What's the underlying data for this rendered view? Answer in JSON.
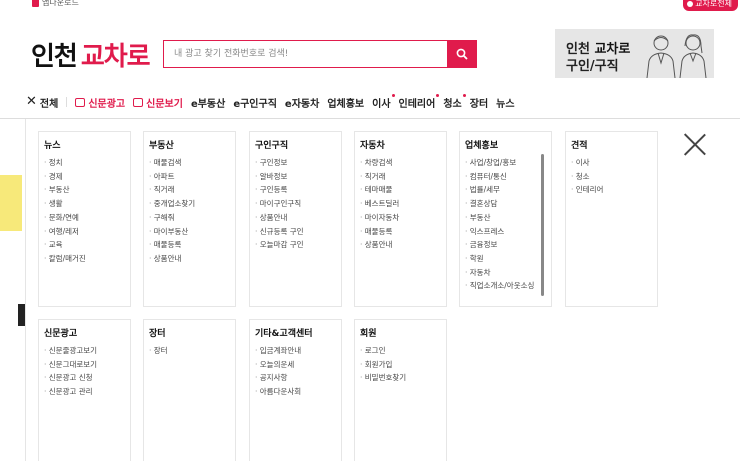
{
  "topbar": {
    "app_download": "앱다운로드",
    "mode_button": "교차로전체"
  },
  "header": {
    "logo_city": "인천",
    "logo_brand": "교차로",
    "search_placeholder": "내 광고 찾기 전화번호로 검색!",
    "banner_line1_a": "인천 ",
    "banner_line1_b": "교차로",
    "banner_line2": "구인/구직"
  },
  "nav": {
    "all": "전체",
    "items": [
      {
        "label": "신문광고"
      },
      {
        "label": "신문보기"
      },
      {
        "label": "e부동산"
      },
      {
        "label": "e구인구직"
      },
      {
        "label": "e자동차"
      },
      {
        "label": "업체홍보"
      },
      {
        "label": "이사"
      },
      {
        "label": "인테리어"
      },
      {
        "label": "청소"
      },
      {
        "label": "장터"
      },
      {
        "label": "뉴스"
      }
    ]
  },
  "menu": {
    "news": {
      "title": "뉴스",
      "items": [
        "정치",
        "경제",
        "부동산",
        "생활",
        "문화/연예",
        "여행/레저",
        "교육",
        "칼럼/매거진"
      ]
    },
    "realestate": {
      "title": "부동산",
      "items": [
        "매물검색",
        "아파트",
        "직거래",
        "중개업소찾기",
        "구해줘",
        "마이부동산",
        "매물등록",
        "상품안내"
      ]
    },
    "jobs": {
      "title": "구인구직",
      "items": [
        "구인정보",
        "알바정보",
        "구인등록",
        "마이구인구직",
        "상품안내",
        "신규등록 구인",
        "오늘마감 구인"
      ]
    },
    "car": {
      "title": "자동차",
      "items": [
        "차량검색",
        "직거래",
        "테마매물",
        "베스트딜러",
        "마이자동차",
        "매물등록",
        "상품안내"
      ]
    },
    "business": {
      "title": "업체홍보",
      "items": [
        "사업/창업/홍보",
        "컴퓨터/통신",
        "법률/세무",
        "결혼상담",
        "부동산",
        "익스프레스",
        "금융정보",
        "학원",
        "자동차",
        "직업소개소/아웃소싱"
      ]
    },
    "estimate": {
      "title": "견적",
      "items": [
        "이사",
        "청소",
        "인테리어"
      ]
    },
    "newspaper_ad": {
      "title": "신문광고",
      "items": [
        "신문줄광고보기",
        "신문그대로보기",
        "신문광고 신청",
        "신문광고 관리"
      ]
    },
    "market": {
      "title": "장터",
      "items": [
        "장터"
      ]
    },
    "support": {
      "title": "기타&고객센터",
      "items": [
        "입금계좌안내",
        "오늘의운세",
        "공지사항",
        "아름다운사회"
      ]
    },
    "member": {
      "title": "회원",
      "items": [
        "로그인",
        "회원가입",
        "비밀번호찾기"
      ]
    }
  }
}
